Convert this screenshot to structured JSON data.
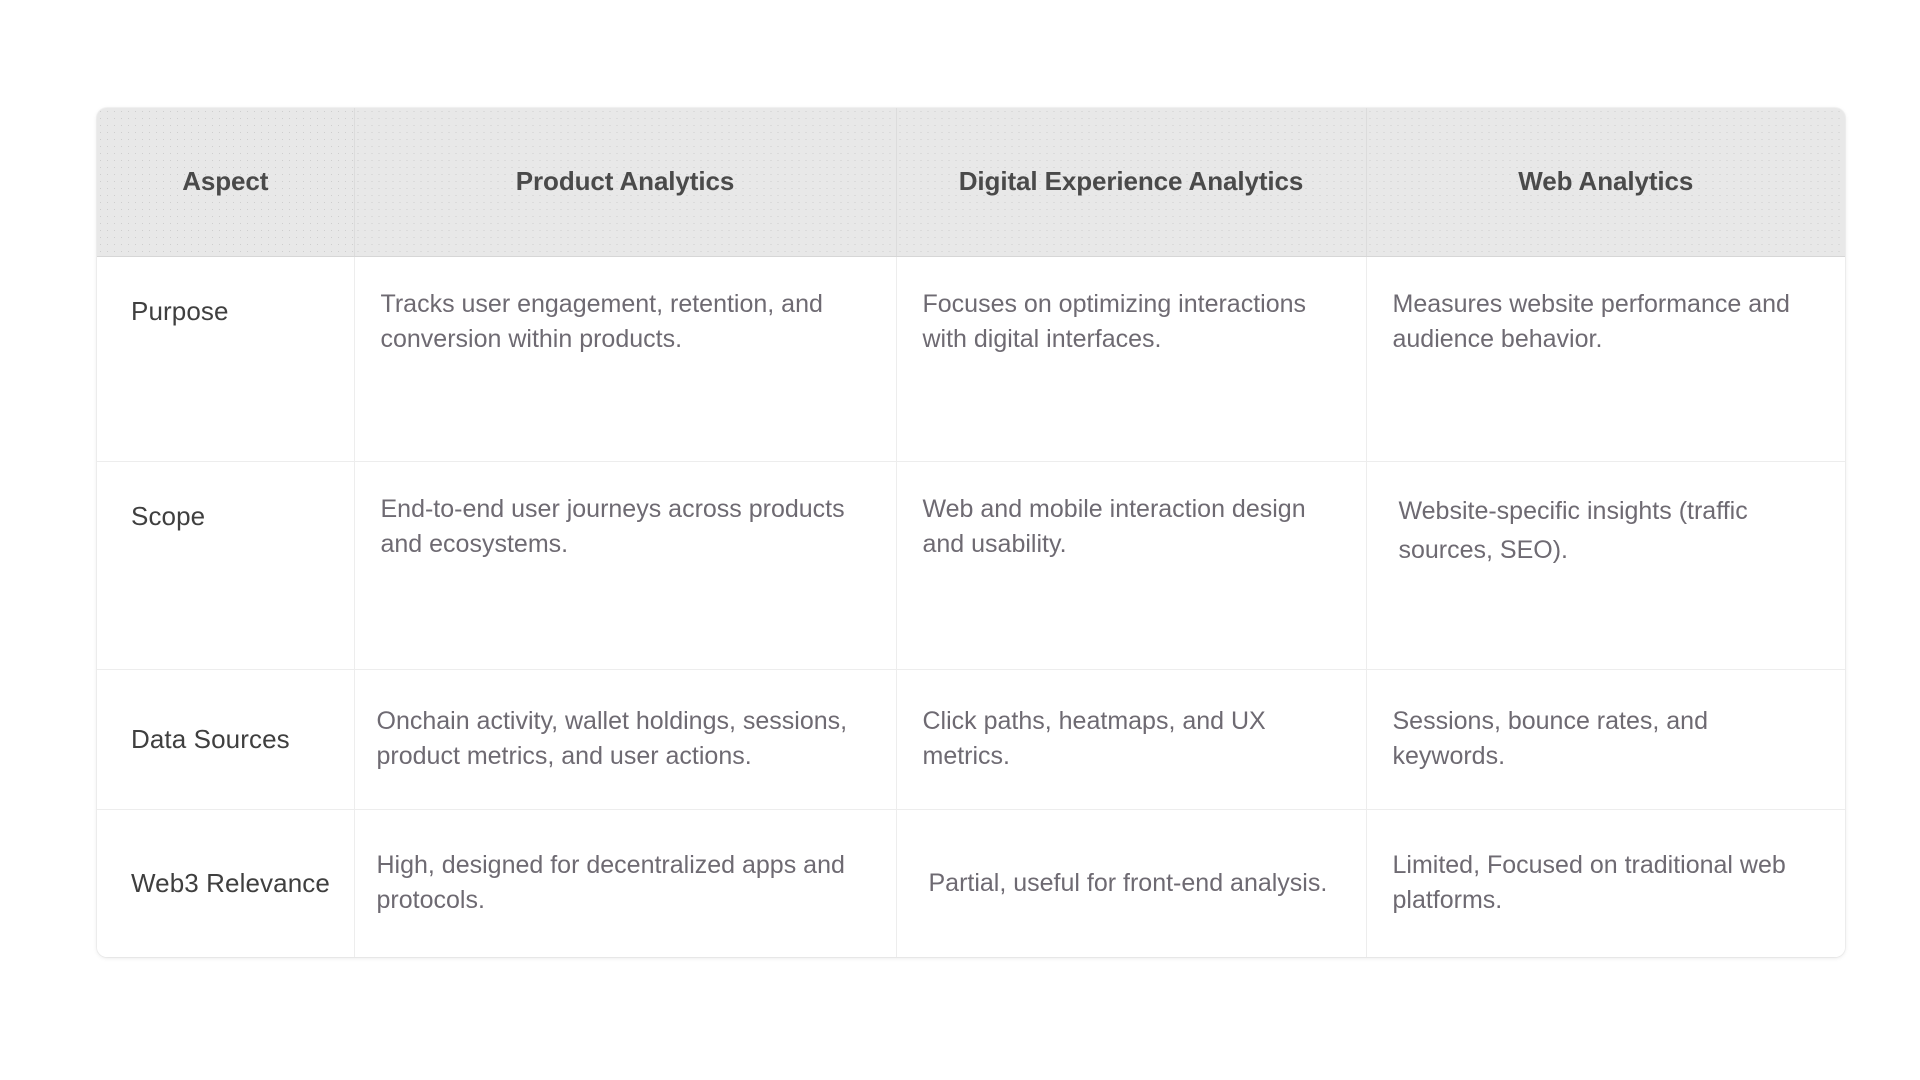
{
  "table": {
    "columns": [
      {
        "key": "aspect",
        "label": "Aspect"
      },
      {
        "key": "product",
        "label": "Product Analytics"
      },
      {
        "key": "dxa",
        "label": "Digital Experience Analytics"
      },
      {
        "key": "web",
        "label": "Web Analytics"
      }
    ],
    "rows": [
      {
        "aspect": "Purpose",
        "product": "Tracks user engagement, retention, and conversion within products.",
        "dxa": "Focuses on optimizing interactions with digital interfaces.",
        "web": "Measures website performance and audience behavior."
      },
      {
        "aspect": "Scope",
        "product": "End-to-end user journeys across products and ecosystems.",
        "dxa": "Web and mobile interaction design and usability.",
        "web": "Website-specific insights (traffic sources, SEO)."
      },
      {
        "aspect": "Data Sources",
        "product": "Onchain activity, wallet holdings, sessions, product metrics, and user actions.",
        "dxa": "Click paths, heatmaps, and UX metrics.",
        "web": "Sessions, bounce rates, and keywords."
      },
      {
        "aspect": "Web3 Relevance",
        "product": "High, designed for decentralized apps and protocols.",
        "dxa": "Partial, useful for front-end analysis.",
        "web": "Limited, Focused on traditional web platforms."
      }
    ]
  },
  "style": {
    "header_background": "#e8e8e8",
    "header_text_color": "#4a4a4a",
    "body_text_color": "#6e6a72",
    "aspect_text_color": "#3f3f3f",
    "grid_line_color": "#ededed",
    "page_background": "#ffffff"
  }
}
